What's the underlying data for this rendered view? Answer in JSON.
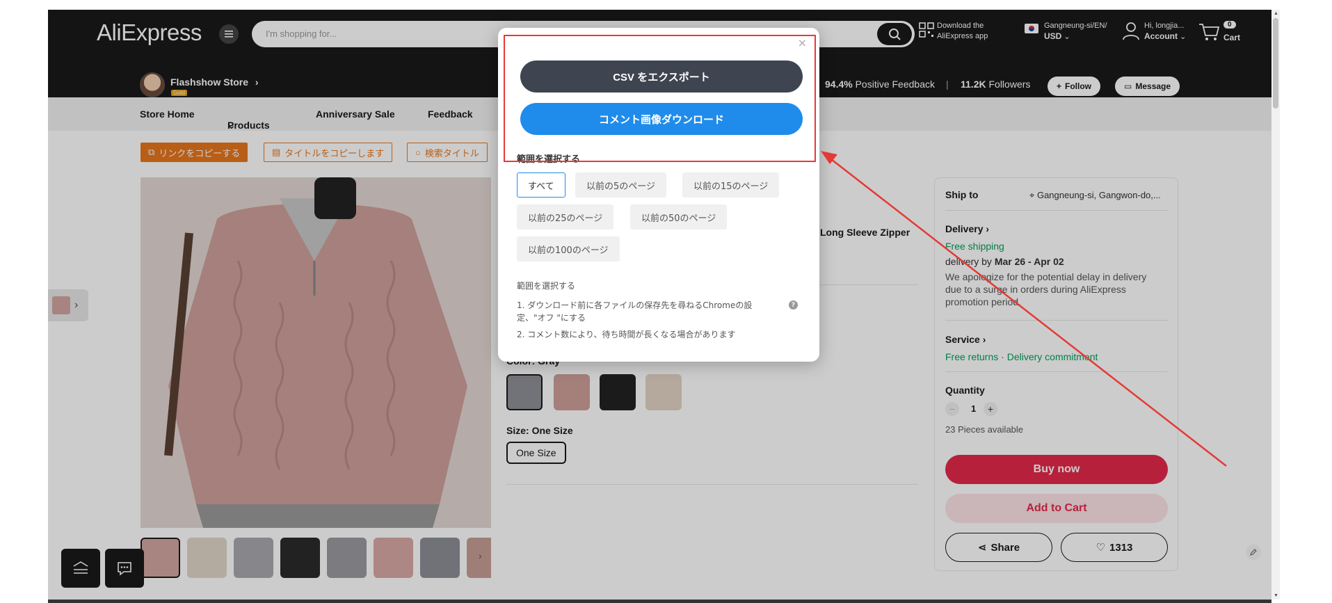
{
  "header": {
    "logo": "AliExpress",
    "search_placeholder": "I'm shopping for...",
    "download_line1": "Download the",
    "download_line2": "AliExpress app",
    "region_line1": "Gangneung-si/EN/",
    "region_line2": "USD",
    "account_line1": "Hi, longjia...",
    "account_line2": "Account",
    "cart_count": "0",
    "cart_label": "Cart"
  },
  "store": {
    "name": "Flashshow Store",
    "badge": "Gold",
    "feedback_value": "94.4%",
    "feedback_label": "Positive Feedback",
    "followers_value": "11.2K",
    "followers_label": "Followers",
    "follow_label": "Follow",
    "message_label": "Message"
  },
  "nav": {
    "items": [
      "Store Home",
      "Products",
      "Anniversary Sale",
      "Feedback"
    ]
  },
  "toolbar": {
    "copy_link": "リンクをコピーする",
    "copy_title": "タイトルをコピーします",
    "search_title": "検索タイトル"
  },
  "product": {
    "title_fragment": "Long Sleeve Zipper",
    "color_label": "Color: Gray",
    "size_label": "Size: One Size",
    "size_value": "One Size"
  },
  "shipping": {
    "ship_to_label": "Ship to",
    "ship_to_value": "Gangneung-si, Gangwon-do,...",
    "delivery_label": "Delivery",
    "free_shipping": "Free shipping",
    "delivery_by": "delivery by",
    "delivery_dates": "Mar 26 - Apr 02",
    "delay_note": "We apologize for the potential delay in delivery due to a surge in orders during AliExpress promotion period.",
    "service_label": "Service",
    "free_returns": "Free returns",
    "separator": "·",
    "delivery_commitment": "Delivery commitment",
    "quantity_label": "Quantity",
    "quantity_value": "1",
    "pieces_available": "23 Pieces available",
    "buy_now": "Buy now",
    "add_to_cart": "Add to Cart",
    "share": "Share",
    "wishlist_count": "1313"
  },
  "modal": {
    "export_csv": "CSV をエクスポート",
    "download_images": "コメント画像ダウンロード",
    "range_title": "範囲を選択する",
    "ranges": [
      "すべて",
      "以前の5のページ",
      "以前の15のページ",
      "以前の25のページ",
      "以前の50のページ",
      "以前の100のページ"
    ],
    "notes_title": "範囲を選択する",
    "note1": "1. ダウンロード前に各ファイルの保存先を尋ねるChromeの設定、\"オフ \"にする",
    "note2": "2. コメント数により、待ち時間が長くなる場合があります",
    "close": "×",
    "help": "?"
  },
  "colors": {
    "header_bg": "#191919",
    "accent_red": "#e5294a",
    "accent_orange": "#e8761c",
    "modal_blue": "#1f8ceb",
    "modal_dark": "#3e4450",
    "annotation_red": "#e53935",
    "green": "#00a05a"
  }
}
